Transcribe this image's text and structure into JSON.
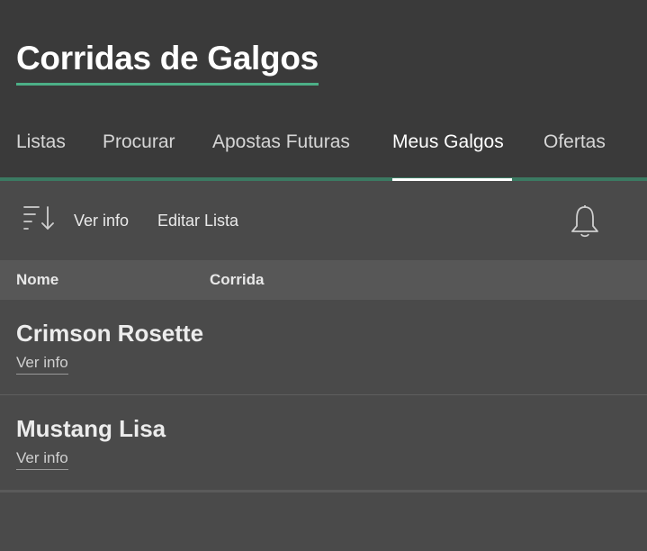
{
  "header": {
    "title": "Corridas de Galgos"
  },
  "tabs": [
    {
      "label": "Listas"
    },
    {
      "label": "Procurar"
    },
    {
      "label": "Apostas Futuras"
    },
    {
      "label": "Meus Galgos"
    },
    {
      "label": "Ofertas"
    }
  ],
  "active_tab": "Meus Galgos",
  "toolbar": {
    "sort_icon": "sort-lines-arrow-icon",
    "info_label": "Ver info",
    "edit_label": "Editar Lista",
    "bell_icon": "bell-icon"
  },
  "columns": {
    "name": "Nome",
    "race": "Corrida"
  },
  "rows": [
    {
      "name": "Crimson Rosette",
      "link": "Ver info"
    },
    {
      "name": "Mustang Lisa",
      "link": "Ver info"
    }
  ],
  "colors": {
    "accent": "#4caf87",
    "header_bg": "#3a3a3a",
    "body_bg": "#4a4a4a"
  }
}
